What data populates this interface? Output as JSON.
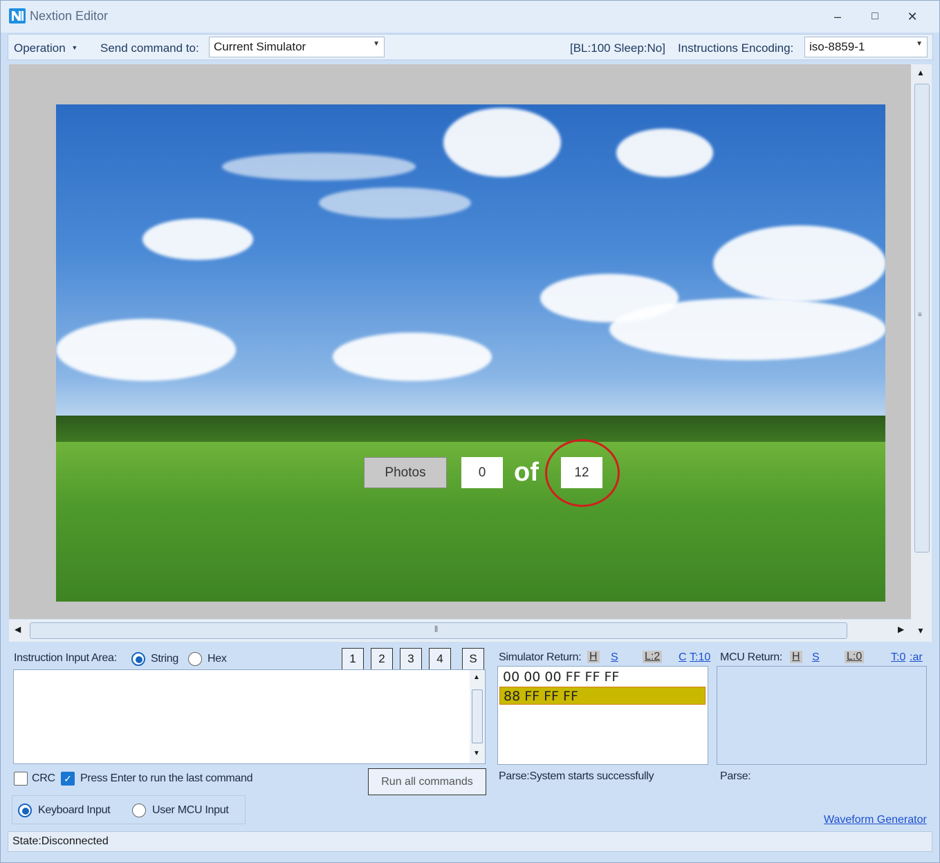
{
  "window": {
    "title": "Nextion Editor",
    "minimize": "–",
    "maximize": "□",
    "close": "✕"
  },
  "toolbar": {
    "operation_menu": "Operation",
    "send_command_label": "Send command to:",
    "send_command_value": "Current Simulator",
    "status_info": "[BL:100  Sleep:No]",
    "encoding_label": "Instructions Encoding:",
    "encoding_value": "iso-8859-1"
  },
  "simulator": {
    "photos_button": "Photos",
    "current_index": "0",
    "of_label": "of",
    "total_count": "12"
  },
  "instruction": {
    "area_label": "Instruction Input Area:",
    "mode_string": "String",
    "mode_hex": "Hex",
    "mode_selected": "String",
    "quick_buttons": [
      "1",
      "2",
      "3",
      "4",
      "S"
    ],
    "crc_label": "CRC",
    "crc_checked": false,
    "press_enter_label": "Press Enter to run the last command",
    "press_enter_checked": true,
    "run_all_button": "Run all commands",
    "input_keyboard": "Keyboard Input",
    "input_mcu": "User MCU Input",
    "input_selected": "Keyboard Input"
  },
  "simulator_return": {
    "label": "Simulator Return:",
    "h": "H",
    "s": "S",
    "l": "L:2",
    "c": "C",
    "t": "T:10",
    "lines": [
      "00 00 00 FF FF FF",
      "88 FF FF FF"
    ],
    "highlight_color": "#c8b900",
    "parse_text": "Parse:System starts successfully"
  },
  "mcu_return": {
    "label": "MCU Return:",
    "h": "H",
    "s": "S",
    "l": "L:0",
    "t": "T:0",
    "clear": ":ar",
    "parse_text": "Parse:"
  },
  "links": {
    "waveform": "Waveform Generator"
  },
  "status": {
    "state": "State:Disconnected"
  }
}
